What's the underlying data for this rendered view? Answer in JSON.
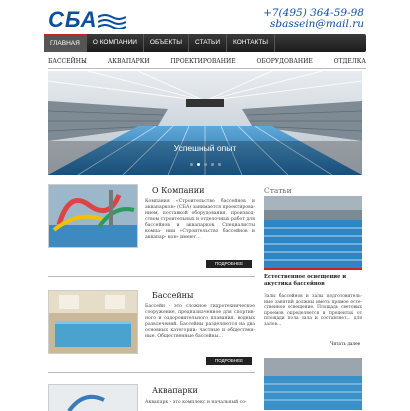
{
  "header": {
    "logo_text": "СБА",
    "phone": "+7(495) 364-59-98",
    "email": "sbassein@mail.ru"
  },
  "topnav": [
    "ГЛАВНАЯ",
    "О КОМПАНИИ",
    "ОБЪЕКТЫ",
    "СТАТЬИ",
    "КОНТАКТЫ"
  ],
  "subnav": [
    "БАССЕЙНЫ",
    "АКВАПАРКИ",
    "ПРОЕКТИРОВАНИЕ",
    "ОБОРУДОВАНИЕ",
    "ОТДЕЛКА"
  ],
  "hero": {
    "caption": "Успешный опыт",
    "slides": 5,
    "active_slide": 1
  },
  "sections": [
    {
      "title": "О Компании",
      "text": "Компания «Строительство бассейнов и аквапарков» (СБА) занимается проектирова- нием, поставкой оборудования, производ- ством строительных и отделочных работ для бассейнов и аквапарков. Специалисты компа- нии «Строительство бассейнов и аквапар- ков» имеют…",
      "button": "ПОДРОБНЕЕ"
    },
    {
      "title": "Бассейны",
      "text": "Бассейн - это сложное гидротехническое сооружение, предназначенное для спортив- ного и оздоровительного плавания, водных развлечений. Бассейны разделяются на два основных категории: частные и обществен- ные. Общественные бассейны…",
      "button": "ПОДРОБНЕЕ"
    },
    {
      "title": "Аквапарки",
      "text": "Аквапарк - это комплекс и начальный со-",
      "button": ""
    }
  ],
  "sidebar": {
    "title": "Статьи",
    "article1": {
      "heading": "Естественное освещение и акустика бассейнов",
      "text": "Залы бассейнов и залы подготовитель- ные занятий должны иметь прямое есте- ственное освещение. Площадь световых проемов определяется в процентах от площади пола зала и составляет… для залов…",
      "link": "Читать далее"
    }
  },
  "colors": {
    "brand_blue": "#0a4f9e",
    "accent_red": "#cc2222",
    "nav_dark": "#222222"
  }
}
